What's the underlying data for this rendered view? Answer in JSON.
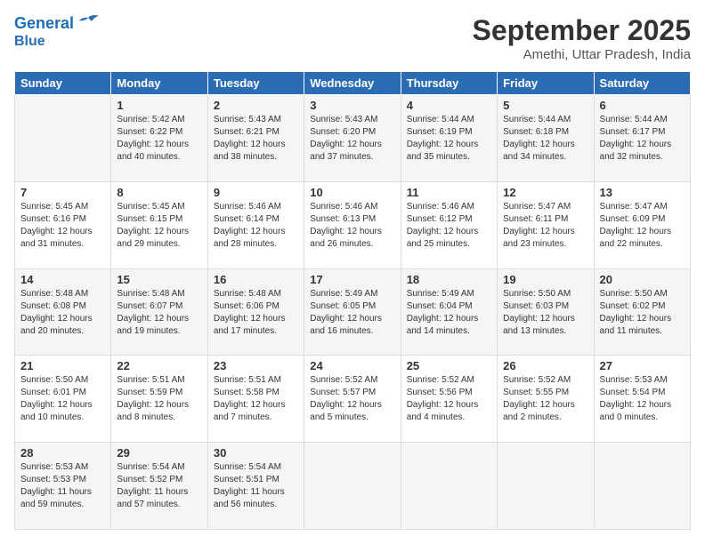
{
  "header": {
    "logo_line1": "General",
    "logo_line2": "Blue",
    "main_title": "September 2025",
    "subtitle": "Amethi, Uttar Pradesh, India"
  },
  "days_of_week": [
    "Sunday",
    "Monday",
    "Tuesday",
    "Wednesday",
    "Thursday",
    "Friday",
    "Saturday"
  ],
  "weeks": [
    [
      {
        "day": "",
        "info": ""
      },
      {
        "day": "1",
        "info": "Sunrise: 5:42 AM\nSunset: 6:22 PM\nDaylight: 12 hours\nand 40 minutes."
      },
      {
        "day": "2",
        "info": "Sunrise: 5:43 AM\nSunset: 6:21 PM\nDaylight: 12 hours\nand 38 minutes."
      },
      {
        "day": "3",
        "info": "Sunrise: 5:43 AM\nSunset: 6:20 PM\nDaylight: 12 hours\nand 37 minutes."
      },
      {
        "day": "4",
        "info": "Sunrise: 5:44 AM\nSunset: 6:19 PM\nDaylight: 12 hours\nand 35 minutes."
      },
      {
        "day": "5",
        "info": "Sunrise: 5:44 AM\nSunset: 6:18 PM\nDaylight: 12 hours\nand 34 minutes."
      },
      {
        "day": "6",
        "info": "Sunrise: 5:44 AM\nSunset: 6:17 PM\nDaylight: 12 hours\nand 32 minutes."
      }
    ],
    [
      {
        "day": "7",
        "info": "Sunrise: 5:45 AM\nSunset: 6:16 PM\nDaylight: 12 hours\nand 31 minutes."
      },
      {
        "day": "8",
        "info": "Sunrise: 5:45 AM\nSunset: 6:15 PM\nDaylight: 12 hours\nand 29 minutes."
      },
      {
        "day": "9",
        "info": "Sunrise: 5:46 AM\nSunset: 6:14 PM\nDaylight: 12 hours\nand 28 minutes."
      },
      {
        "day": "10",
        "info": "Sunrise: 5:46 AM\nSunset: 6:13 PM\nDaylight: 12 hours\nand 26 minutes."
      },
      {
        "day": "11",
        "info": "Sunrise: 5:46 AM\nSunset: 6:12 PM\nDaylight: 12 hours\nand 25 minutes."
      },
      {
        "day": "12",
        "info": "Sunrise: 5:47 AM\nSunset: 6:11 PM\nDaylight: 12 hours\nand 23 minutes."
      },
      {
        "day": "13",
        "info": "Sunrise: 5:47 AM\nSunset: 6:09 PM\nDaylight: 12 hours\nand 22 minutes."
      }
    ],
    [
      {
        "day": "14",
        "info": "Sunrise: 5:48 AM\nSunset: 6:08 PM\nDaylight: 12 hours\nand 20 minutes."
      },
      {
        "day": "15",
        "info": "Sunrise: 5:48 AM\nSunset: 6:07 PM\nDaylight: 12 hours\nand 19 minutes."
      },
      {
        "day": "16",
        "info": "Sunrise: 5:48 AM\nSunset: 6:06 PM\nDaylight: 12 hours\nand 17 minutes."
      },
      {
        "day": "17",
        "info": "Sunrise: 5:49 AM\nSunset: 6:05 PM\nDaylight: 12 hours\nand 16 minutes."
      },
      {
        "day": "18",
        "info": "Sunrise: 5:49 AM\nSunset: 6:04 PM\nDaylight: 12 hours\nand 14 minutes."
      },
      {
        "day": "19",
        "info": "Sunrise: 5:50 AM\nSunset: 6:03 PM\nDaylight: 12 hours\nand 13 minutes."
      },
      {
        "day": "20",
        "info": "Sunrise: 5:50 AM\nSunset: 6:02 PM\nDaylight: 12 hours\nand 11 minutes."
      }
    ],
    [
      {
        "day": "21",
        "info": "Sunrise: 5:50 AM\nSunset: 6:01 PM\nDaylight: 12 hours\nand 10 minutes."
      },
      {
        "day": "22",
        "info": "Sunrise: 5:51 AM\nSunset: 5:59 PM\nDaylight: 12 hours\nand 8 minutes."
      },
      {
        "day": "23",
        "info": "Sunrise: 5:51 AM\nSunset: 5:58 PM\nDaylight: 12 hours\nand 7 minutes."
      },
      {
        "day": "24",
        "info": "Sunrise: 5:52 AM\nSunset: 5:57 PM\nDaylight: 12 hours\nand 5 minutes."
      },
      {
        "day": "25",
        "info": "Sunrise: 5:52 AM\nSunset: 5:56 PM\nDaylight: 12 hours\nand 4 minutes."
      },
      {
        "day": "26",
        "info": "Sunrise: 5:52 AM\nSunset: 5:55 PM\nDaylight: 12 hours\nand 2 minutes."
      },
      {
        "day": "27",
        "info": "Sunrise: 5:53 AM\nSunset: 5:54 PM\nDaylight: 12 hours\nand 0 minutes."
      }
    ],
    [
      {
        "day": "28",
        "info": "Sunrise: 5:53 AM\nSunset: 5:53 PM\nDaylight: 11 hours\nand 59 minutes."
      },
      {
        "day": "29",
        "info": "Sunrise: 5:54 AM\nSunset: 5:52 PM\nDaylight: 11 hours\nand 57 minutes."
      },
      {
        "day": "30",
        "info": "Sunrise: 5:54 AM\nSunset: 5:51 PM\nDaylight: 11 hours\nand 56 minutes."
      },
      {
        "day": "",
        "info": ""
      },
      {
        "day": "",
        "info": ""
      },
      {
        "day": "",
        "info": ""
      },
      {
        "day": "",
        "info": ""
      }
    ]
  ]
}
